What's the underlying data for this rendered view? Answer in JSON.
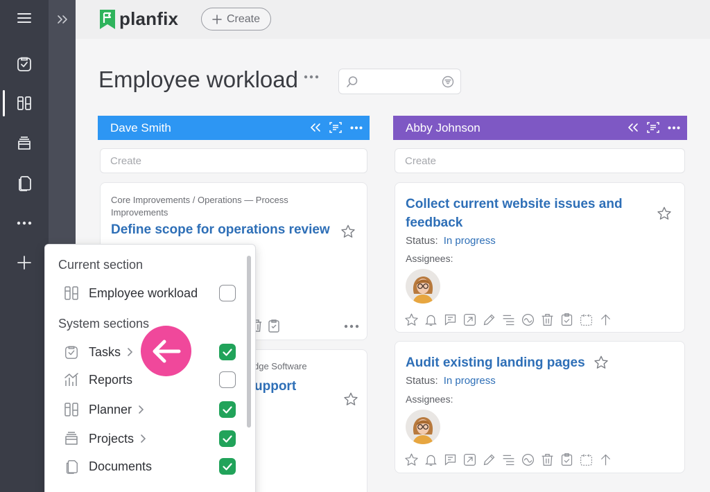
{
  "app": {
    "logo_text": "planfix",
    "create_label": "Create"
  },
  "page": {
    "title": "Employee workload",
    "search_placeholder": ""
  },
  "columns": [
    {
      "name": "Dave Smith",
      "color": "#2d96f3",
      "create_placeholder": "Create",
      "cards": [
        {
          "path": "Core Improvements / Operations — Process Improvements",
          "title": "Define scope for operations review"
        },
        {
          "path_fragment": "dge Software",
          "title_fragment": "upport"
        }
      ]
    },
    {
      "name": "Abby Johnson",
      "color": "#7e58c4",
      "create_placeholder": "Create",
      "cards": [
        {
          "title": "Collect current website issues and feedback",
          "status_label": "Status:",
          "status_value": "In progress",
          "assignees_label": "Assignees:"
        },
        {
          "title": "Audit existing landing pages",
          "status_label": "Status:",
          "status_value": "In progress",
          "assignees_label": "Assignees:"
        }
      ]
    }
  ],
  "popup": {
    "current_heading": "Current section",
    "current_items": [
      {
        "label": "Employee workload",
        "checked": false,
        "icon": "planner-icon"
      }
    ],
    "system_heading": "System sections",
    "system_items": [
      {
        "label": "Tasks",
        "checked": true,
        "has_submenu": true,
        "icon": "tasks-icon"
      },
      {
        "label": "Reports",
        "checked": false,
        "has_submenu": false,
        "icon": "reports-icon"
      },
      {
        "label": "Planner",
        "checked": true,
        "has_submenu": true,
        "icon": "planner-icon"
      },
      {
        "label": "Projects",
        "checked": true,
        "has_submenu": true,
        "icon": "projects-icon"
      },
      {
        "label": "Documents",
        "checked": true,
        "has_submenu": false,
        "icon": "documents-icon"
      }
    ]
  },
  "colors": {
    "accent_link": "#2e6fb7",
    "check_green": "#21a35a",
    "highlight_pink": "#f0489b",
    "rail": "#3a3d47"
  }
}
